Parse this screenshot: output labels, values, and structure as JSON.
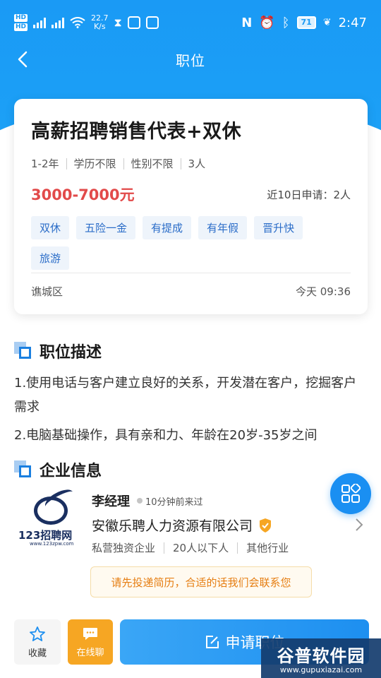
{
  "status_bar": {
    "hd1": "HD",
    "hd2": "HD",
    "net_speed_value": "22.7",
    "net_speed_unit": "K/s",
    "battery": "71",
    "time": "2:47"
  },
  "nav": {
    "title": "职位"
  },
  "job": {
    "title": "高薪招聘销售代表+双休",
    "requirements": [
      "1-2年",
      "学历不限",
      "性别不限",
      "3人"
    ],
    "salary": "3000-7000元",
    "applies": "近10日申请：2人",
    "tags": [
      "双休",
      "五险一金",
      "有提成",
      "有年假",
      "晋升快",
      "旅游"
    ],
    "district": "谯城区",
    "posted": "今天 09:36"
  },
  "description": {
    "heading": "职位描述",
    "lines": [
      "1.使用电话与客户建立良好的关系，开发潜在客户，挖掘客户需求",
      "2.电脑基础操作，具有亲和力、年龄在20岁-35岁之间"
    ]
  },
  "company": {
    "heading": "企业信息",
    "logo_text": "123招聘网",
    "logo_url": "www.123zpw.com",
    "contact_name": "李经理",
    "contact_time": "10分钟前来过",
    "name": "安徽乐聘人力资源有限公司",
    "meta": [
      "私营独资企业",
      "20人以下人",
      "其他行业"
    ],
    "notice": "请先投递简历，合适的话我们会联系您"
  },
  "bottom": {
    "favorite_label": "收藏",
    "chat_label": "在线聊",
    "apply_label": "申请职位"
  },
  "watermark": {
    "main": "谷普软件园",
    "url": "www.gupuxiazai.com"
  },
  "colors": {
    "primary": "#1a9af5",
    "salary": "#e24a4a",
    "accent_orange": "#f6a623"
  }
}
